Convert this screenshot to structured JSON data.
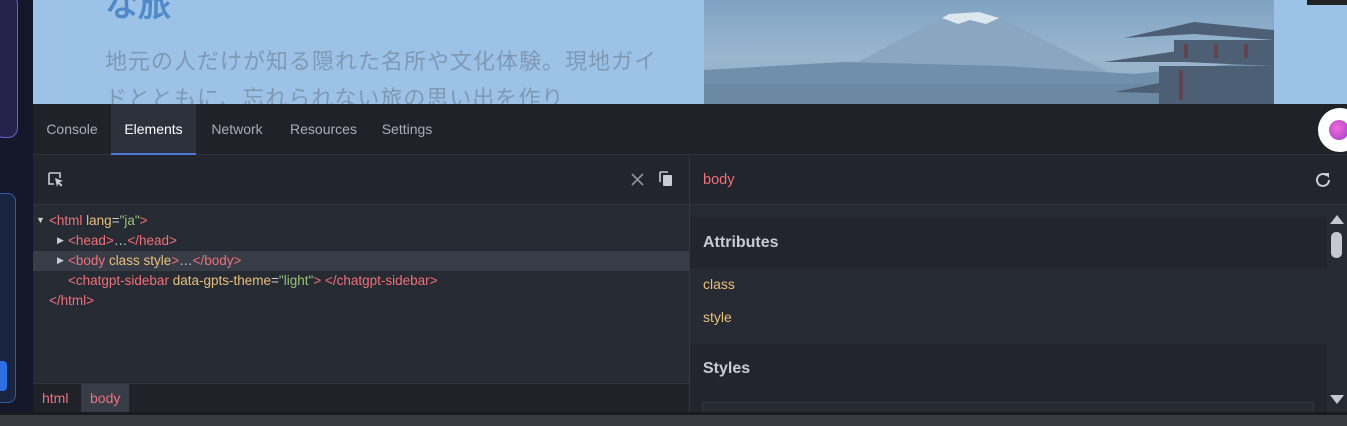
{
  "page_preview": {
    "heading": "な旅",
    "body_text": "地元の人だけが知る隠れた名所や文化体験。現地ガイドとともに、忘れられない旅の思い出を作り"
  },
  "devtools": {
    "tabs": [
      {
        "label": "Console",
        "active": false
      },
      {
        "label": "Elements",
        "active": true
      },
      {
        "label": "Network",
        "active": false
      },
      {
        "label": "Resources",
        "active": false
      },
      {
        "label": "Settings",
        "active": false
      }
    ],
    "extension_icon": "brain-icon",
    "elements": {
      "toolbar_icons": [
        "element-picker-icon",
        "close-icon",
        "copy-icon"
      ],
      "tree": {
        "html_open": {
          "tag": "<html",
          "attr": "lang",
          "eq": "=",
          "val": "\"ja\"",
          "close": ">"
        },
        "head": {
          "open": "<head>",
          "dots": "…",
          "close": "</head>"
        },
        "body": {
          "open": "<body",
          "attrs": "class style",
          "gt": ">",
          "dots": "…",
          "close": "</body>"
        },
        "sidebar": {
          "open": "<chatgpt-sidebar",
          "attr": "data-gpts-theme",
          "eq": "=",
          "val": "\"light\"",
          "gt": ">",
          "close": "</chatgpt-sidebar>"
        },
        "html_close": "</html>"
      },
      "breadcrumbs": [
        {
          "label": "html",
          "active": false
        },
        {
          "label": "body",
          "active": true
        }
      ]
    },
    "sidepanel": {
      "title": "body",
      "refresh_icon": "refresh-icon",
      "attributes_heading": "Attributes",
      "attributes": [
        "class",
        "style"
      ],
      "styles_heading": "Styles"
    }
  },
  "colors": {
    "tag": "#f0707a",
    "attribute": "#e7c07b",
    "value": "#98c379",
    "active_tab_underline": "#4a78d4"
  }
}
